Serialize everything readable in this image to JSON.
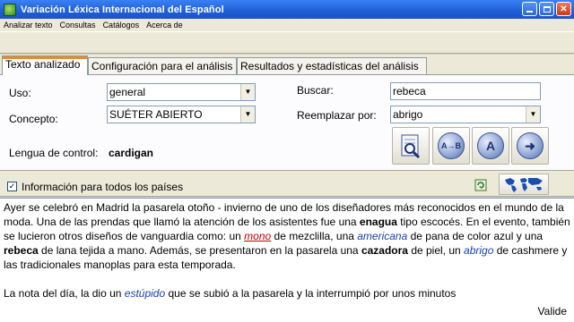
{
  "window": {
    "title": "Variación Léxica Internacional del Español"
  },
  "menu": [
    "Analizar texto",
    "Consultas",
    "Catálogos",
    "Acerca de"
  ],
  "tabs": [
    {
      "label": "Texto analizado",
      "active": true
    },
    {
      "label": "Configuración para el análisis",
      "active": false
    },
    {
      "label": "Resultados y estadísticas del análisis",
      "active": false
    }
  ],
  "form": {
    "uso_label": "Uso:",
    "uso_value": "general",
    "concepto_label": "Concepto:",
    "concepto_value": "SUÉTER ABIERTO",
    "lengua_label": "Lengua de control:",
    "lengua_value": "cardigan",
    "buscar_label": "Buscar:",
    "buscar_value": "rebeca",
    "reemplazar_label": "Reemplazar por:",
    "reemplazar_value": "abrigo"
  },
  "tool_buttons": [
    "search-doc-icon",
    "replace-ab-icon",
    "font-a-icon",
    "exit-arrow-icon"
  ],
  "info": {
    "checked": true,
    "label": "Información para todos los países"
  },
  "text": {
    "p1": [
      {
        "t": "Ayer se celebró en Madrid la pasarela otoño - invierno de uno de los diseñadores más reconocidos en el mundo de la moda. Una de las prendas que llamó la atención de los asistentes fue una ",
        "s": ""
      },
      {
        "t": "enagua",
        "s": "b"
      },
      {
        "t": " tipo escocés. En el evento, también se lucieron otros diseños de vanguardia como: un ",
        "s": ""
      },
      {
        "t": "mono",
        "s": "red"
      },
      {
        "t": " de mezclilla, una ",
        "s": ""
      },
      {
        "t": "americana",
        "s": "blue"
      },
      {
        "t": " de pana de color azul y una ",
        "s": ""
      },
      {
        "t": "rebeca",
        "s": "b"
      },
      {
        "t": " de lana tejida a mano. Además, se presentaron en la pasarela una ",
        "s": ""
      },
      {
        "t": "cazadora",
        "s": "b"
      },
      {
        "t": " de piel, un ",
        "s": ""
      },
      {
        "t": "abrigo",
        "s": "blue"
      },
      {
        "t": " de cashmere y las tradicionales manoplas para esta temporada.",
        "s": ""
      }
    ],
    "p2": [
      {
        "t": "La nota del día, la dio un ",
        "s": ""
      },
      {
        "t": "estúpido",
        "s": "blue"
      },
      {
        "t": " que se subió a la pasarela y la interrumpió por unos minutos",
        "s": ""
      }
    ],
    "status": "Valide"
  },
  "colors": {
    "titlebar": "#1f5fd6",
    "marked_red": "#c00000",
    "marked_blue": "#1a3fb0",
    "tab_accent": "#e68b2c"
  }
}
